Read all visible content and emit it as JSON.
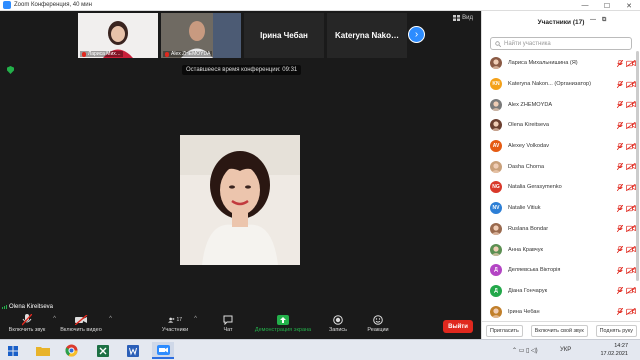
{
  "window": {
    "title": "Zoom Конференция, 40 мин",
    "controls": {
      "minimize": "—",
      "maximize": "☐",
      "close": "✕"
    }
  },
  "top_strip": {
    "tiles": [
      {
        "name": "Лариса Мих…",
        "type": "video",
        "muted": true
      },
      {
        "name": "Alex ZHEMOYDA",
        "type": "video",
        "muted": true
      },
      {
        "name": "Ірина Чебан",
        "type": "name"
      },
      {
        "name": "Kateryna Nako…",
        "type": "name"
      }
    ],
    "next_icon": "chevron-right",
    "view_label": "Вид"
  },
  "timer": "Оставшееся время конференции: 09:31",
  "active_speaker": "Olena Kireitseva",
  "toolbar": {
    "audio_label": "Включить звук",
    "video_label": "Включить видео",
    "participants_label": "Участники",
    "participants_count": "17",
    "chat_label": "Чат",
    "share_label": "Демонстрация экрана",
    "record_label": "Запись",
    "reactions_label": "Реакции",
    "end_label": "Выйти",
    "share_color": "#23b04a"
  },
  "panel": {
    "title": "Участники (17)",
    "search_placeholder": "Найти участника",
    "participants": [
      {
        "name": "Лариса  Михальнишина (Я)",
        "initials": "",
        "color": "#8a5a44",
        "photo": true
      },
      {
        "name": "Kateryna Nakon... (Организатор)",
        "initials": "KN",
        "color": "#f4a11a",
        "photo": false
      },
      {
        "name": "Alex ZHEMOYDA",
        "initials": "",
        "color": "#7a7a7a",
        "photo": true
      },
      {
        "name": "Olena Kireitseva",
        "initials": "",
        "color": "#6b3f2f",
        "photo": true
      },
      {
        "name": "Alexey Volkodav",
        "initials": "AV",
        "color": "#e55b13",
        "photo": false
      },
      {
        "name": "Dasha Chorna",
        "initials": "",
        "color": "#c9a07a",
        "photo": true
      },
      {
        "name": "Natalia Gerasymenko",
        "initials": "NG",
        "color": "#d9382a",
        "photo": false
      },
      {
        "name": "Natalie Vitiuk",
        "initials": "NV",
        "color": "#2d7fd6",
        "photo": false
      },
      {
        "name": "Ruslana Bondar",
        "initials": "",
        "color": "#9a6a4e",
        "photo": true
      },
      {
        "name": "Анна Кравчук",
        "initials": "",
        "color": "#5c8f52",
        "photo": true
      },
      {
        "name": "Деляевська Вікторія",
        "initials": "Д",
        "color": "#b345c4",
        "photo": false
      },
      {
        "name": "Діана Гончарук",
        "initials": "Д",
        "color": "#23a84a",
        "photo": false
      },
      {
        "name": "Ірина Чебан",
        "initials": "",
        "color": "#c17f2a",
        "photo": true
      }
    ],
    "footer": {
      "invite": "Пригласить",
      "unmute": "Включить свой звук",
      "raise": "Поднять руку"
    }
  },
  "taskbar": {
    "lang": "УКР",
    "time": "14:27",
    "date": "17.02.2021"
  }
}
